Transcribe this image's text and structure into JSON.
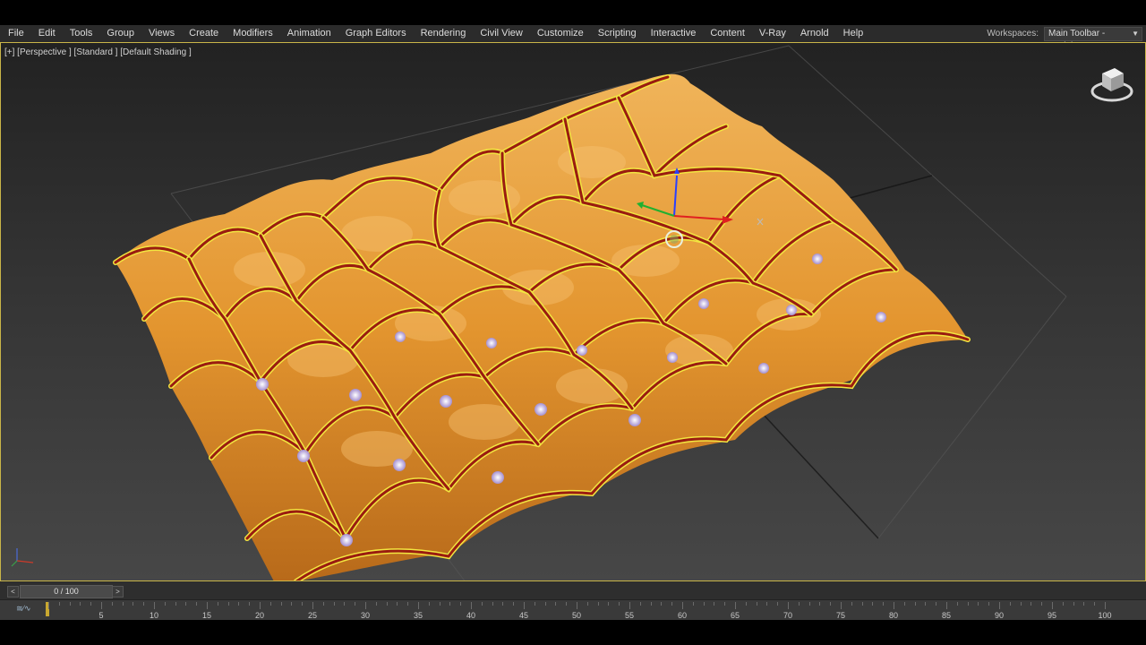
{
  "menu": {
    "items": [
      "File",
      "Edit",
      "Tools",
      "Group",
      "Views",
      "Create",
      "Modifiers",
      "Animation",
      "Graph Editors",
      "Rendering",
      "Civil View",
      "Customize",
      "Scripting",
      "Interactive",
      "Content",
      "V-Ray",
      "Arnold",
      "Help"
    ]
  },
  "workspace": {
    "label": "Workspaces:",
    "value": "Main Toolbar - modular"
  },
  "viewport": {
    "label": "[+] [Perspective ] [Standard ] [Default Shading ]"
  },
  "timeline": {
    "slider_text": "0 / 100",
    "prev_icon": "chevron-left-icon",
    "next_icon": "chevron-right-icon",
    "ticks": [
      "5",
      "10",
      "15",
      "20",
      "25",
      "30",
      "35",
      "40",
      "45",
      "50",
      "55",
      "60",
      "65",
      "70",
      "75",
      "80",
      "85",
      "90",
      "95",
      "100"
    ]
  },
  "colors": {
    "surface": "#e0952f",
    "frame_rib": "#9a1c10",
    "selection": "#f2e640",
    "node": "#c9b7e8",
    "viewport_border": "#c9b548"
  }
}
